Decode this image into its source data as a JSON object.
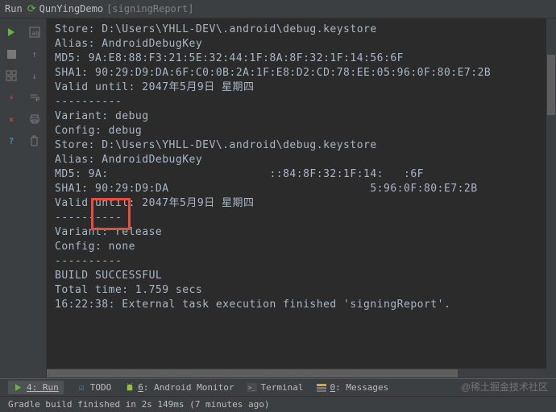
{
  "header": {
    "run_label": "Run",
    "project": "QunYingDemo",
    "task": "[signingReport]"
  },
  "console": {
    "lines": [
      "Store: D:\\Users\\YHLL-DEV\\.android\\debug.keystore",
      "Alias: AndroidDebugKey",
      "MD5: 9A:E8:88:F3:21:5E:32:44:1F:8A:8F:32:1F:14:56:6F",
      "SHA1: 90:29:D9:DA:6F:C0:0B:2A:1F:E8:D2:CD:78:EE:05:96:0F:80:E7:2B",
      "Valid until: 2047年5月9日 星期四",
      "----------",
      "Variant: debug",
      "Config: debug",
      "Store: D:\\Users\\YHLL-DEV\\.android\\debug.keystore",
      "Alias: AndroidDebugKey",
      "MD5: 9A:                        ::84:8F:32:1F:14:   :6F",
      "SHA1: 90:29:D9:DA                              5:96:0F:80:E7:2B",
      "Valid until: 2047年5月9日 星期四",
      "----------",
      "Variant: release",
      "Config: none",
      "----------",
      "",
      "BUILD SUCCESSFUL",
      "",
      "Total time: 1.759 secs",
      "16:22:38: External task execution finished 'signingReport'."
    ]
  },
  "tabs": {
    "run": "4: Run",
    "todo": "TODO",
    "android": "6: Android Monitor",
    "terminal": "Terminal",
    "messages": "0: Messages"
  },
  "status": {
    "text": "Gradle build finished in 2s 149ms (7 minutes ago)"
  },
  "watermark": "@稀土掘金技术社区"
}
